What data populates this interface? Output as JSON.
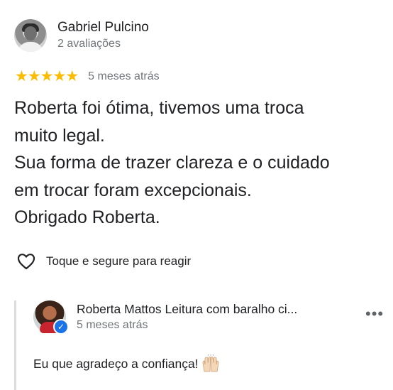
{
  "review": {
    "author_name": "Gabriel Pulcino",
    "author_meta": "2 avaliações",
    "rating": 5,
    "rating_max": 5,
    "time": "5 meses atrás",
    "text_lines": [
      "Roberta foi ótima, tivemos uma troca",
      "muito legal.",
      "Sua forma de trazer clareza e o cuidado",
      "em trocar foram excepcionais.",
      "Obrigado Roberta."
    ],
    "react_label": "Toque e segure para reagir"
  },
  "reply": {
    "author_name": "Roberta Mattos Leitura com baralho ci...",
    "time": "5 meses atrás",
    "text": "Eu que agradeço a confiança!",
    "emoji": "raising-hands-icon"
  },
  "colors": {
    "star": "#fbbc04",
    "verified": "#1a73e8",
    "muted_text": "#70757a"
  }
}
